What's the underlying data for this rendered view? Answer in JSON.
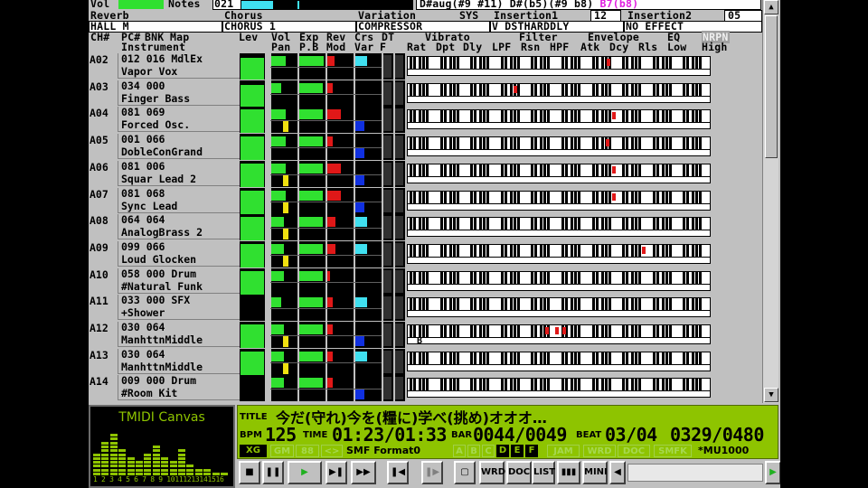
{
  "top": {
    "vol_label": "Vol",
    "notes_label": "Notes",
    "notes_value": "021",
    "chord_text": "D#aug(#9 #11) D#(b5)(#9 b8)",
    "chord_highlight": "B7(b8)"
  },
  "effects": {
    "reverb_label": "Reverb",
    "reverb_value": "HALL M",
    "chorus_label": "Chorus",
    "chorus_value": "CHORUS 1",
    "variation_label": "Variation",
    "variation_mode": "SYS",
    "variation_value": "COMPRESSOR",
    "insertion1_label": "Insertion1",
    "insertion1_num": "12",
    "insertion1_value": "V DSTHARDDLY",
    "insertion2_label": "Insertion2",
    "insertion2_num": "05",
    "insertion2_value": "NO EFFECT"
  },
  "headers": {
    "row1": [
      "CH#",
      "PC#",
      "BNK",
      "Map",
      "Lev",
      "Vol",
      "Exp",
      "Rev",
      "Crs",
      "DT",
      "Vibrato",
      "Filter",
      "Envelope",
      "EQ",
      "NRPN"
    ],
    "row2": [
      "Instrument",
      "Pan",
      "P.B",
      "Mod",
      "Var",
      "F",
      "Rat",
      "Dpt",
      "Dly",
      "LPF",
      "Rsn",
      "HPF",
      "Atk",
      "Dcy",
      "Rls",
      "Low",
      "High"
    ]
  },
  "channels": [
    {
      "ch": "A02",
      "line1": "012 016 MdlEx",
      "line2": "Vapor Vox",
      "lev": 0.9,
      "vol": 0.55,
      "exp": 0.9,
      "rev": 0.25,
      "crs": 0,
      "var": "cyan",
      "pan": "none",
      "hits": [
        220
      ]
    },
    {
      "ch": "A03",
      "line1": "034 000",
      "line2": "Finger Bass",
      "lev": 0.9,
      "vol": 0.4,
      "exp": 0.85,
      "rev": 0.2,
      "crs": 0,
      "var": "none",
      "pan": "none",
      "hits": [
        117
      ]
    },
    {
      "ch": "A04",
      "line1": "081 069",
      "line2": "Forced Osc.",
      "lev": 0.95,
      "vol": 0.55,
      "exp": 0.85,
      "rev": 0.5,
      "crs": 0,
      "var": "blue",
      "pan": "yellow",
      "hits": [
        226
      ]
    },
    {
      "ch": "A05",
      "line1": "001 066",
      "line2": "DobleConGrand",
      "lev": 0.95,
      "vol": 0.55,
      "exp": 0.85,
      "rev": 0.2,
      "crs": 0,
      "var": "blue",
      "pan": "none",
      "hits": [
        219
      ]
    },
    {
      "ch": "A06",
      "line1": "081 006",
      "line2": "Squar Lead 2",
      "lev": 0.95,
      "vol": 0.55,
      "exp": 0.85,
      "rev": 0.5,
      "crs": 0,
      "var": "blue",
      "pan": "yellow",
      "hits": [
        226
      ]
    },
    {
      "ch": "A07",
      "line1": "081 068",
      "line2": "Sync Lead",
      "lev": 0.95,
      "vol": 0.55,
      "exp": 0.85,
      "rev": 0.5,
      "crs": 0,
      "var": "blue",
      "pan": "yellow",
      "hits": [
        226
      ]
    },
    {
      "ch": "A08",
      "line1": "064 064",
      "line2": "AnalogBrass 2",
      "lev": 0.95,
      "vol": 0.5,
      "exp": 0.85,
      "rev": 0.3,
      "crs": 0,
      "var": "cyan",
      "pan": "yellow",
      "hits": []
    },
    {
      "ch": "A09",
      "line1": "099 066",
      "line2": "Loud Glocken",
      "lev": 0.95,
      "vol": 0.5,
      "exp": 0.85,
      "rev": 0.3,
      "crs": 0,
      "var": "cyan",
      "pan": "yellow",
      "hits": [
        259
      ]
    },
    {
      "ch": "A10",
      "line1": "058 000 Drum",
      "line2": "#Natural Funk",
      "lev": 0.95,
      "vol": 0.5,
      "exp": 0.85,
      "rev": 0.1,
      "crs": 0,
      "var": "none",
      "pan": "none",
      "hits": []
    },
    {
      "ch": "A11",
      "line1": "033 000 SFX",
      "line2": "+Shower",
      "lev": 0,
      "vol": 0.4,
      "exp": 0.85,
      "rev": 0.2,
      "crs": 0,
      "var": "cyan",
      "pan": "none",
      "hits": []
    },
    {
      "ch": "A12",
      "line1": "030 064",
      "line2": "ManhttnMiddle",
      "lev": 0.95,
      "vol": 0.5,
      "exp": 0.85,
      "rev": 0.2,
      "crs": 0,
      "var": "blue",
      "pan": "yellow",
      "hits": [
        152,
        163,
        171
      ]
    },
    {
      "ch": "A13",
      "line1": "030 064",
      "line2": "ManhttnMiddle",
      "lev": 0.95,
      "vol": 0.5,
      "exp": 0.85,
      "rev": 0.2,
      "crs": 0,
      "var": "cyan",
      "pan": "yellow",
      "hits": []
    },
    {
      "ch": "A14",
      "line1": "009 000 Drum",
      "line2": "#Room Kit",
      "lev": 0,
      "vol": 0.5,
      "exp": 0.85,
      "rev": 0.2,
      "crs": 0,
      "var": "blue",
      "pan": "none",
      "hits": []
    }
  ],
  "kbd_annotation": "B",
  "canvas": {
    "title": "TMIDI Canvas",
    "channel_numbers": "1 2 3 4 5 6 7 8 9 10111213141516",
    "levels": [
      0.5,
      0.75,
      0.9,
      0.6,
      0.45,
      0.35,
      0.5,
      0.7,
      0.4,
      0.3,
      0.55,
      0.25,
      0.2,
      0.15,
      0.1,
      0.1
    ]
  },
  "lcd": {
    "title_label": "TITLE",
    "title_value": "今だ(守れ)今を(糧に)学べ(挑め)オオオ…",
    "bpm_label": "BPM",
    "bpm_value": "125",
    "time_label": "TIME",
    "time_value": "01:23/01:33",
    "bar_label": "BAR",
    "bar_value": "0044/0049",
    "beat_label": "BEAT",
    "beat_value": "03/04",
    "tick_value": "0329/0480",
    "format": "SMF Format0",
    "module": "*MU1000",
    "tags": [
      "XG",
      "GM",
      "88",
      "<>",
      "A",
      "B",
      "C",
      "D",
      "E",
      "F",
      "JAM",
      "WRD",
      "DOC",
      "SMFK"
    ],
    "tags_on": [
      "XG",
      "D",
      "E",
      "F"
    ]
  },
  "toolbar": {
    "buttons": [
      "■",
      "❚❚",
      "▶",
      "▶❚",
      "▶▶",
      "❚◀",
      "❚▶",
      "▢",
      "WRD",
      "DOC",
      "LIST",
      "▮▮▮",
      "MINI",
      "◀",
      "▶"
    ]
  },
  "colors": {
    "panel": "#c0c0c0",
    "lcd_green": "#8ec400",
    "meter_green": "#30e030",
    "meter_red": "#e01818",
    "meter_yellow": "#f0e010",
    "meter_blue": "#1030e0",
    "meter_cyan": "#40e0f0",
    "chord_highlight": "#e020e0"
  }
}
